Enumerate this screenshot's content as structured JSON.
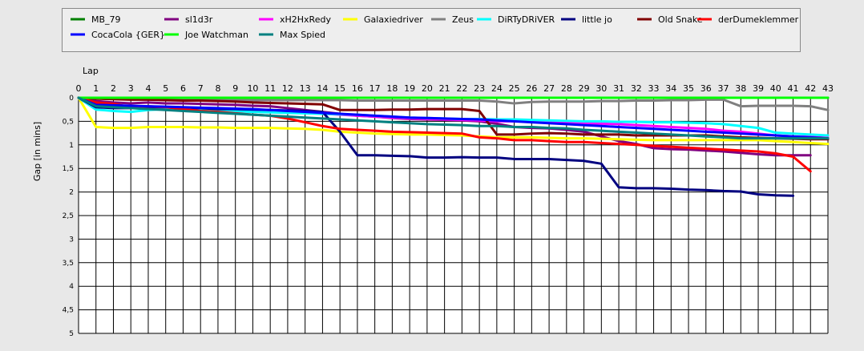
{
  "chart_data": {
    "type": "line",
    "xlabel": "Lap",
    "ylabel": "Gap [in mins]",
    "xlim": [
      0,
      43
    ],
    "ylim": [
      0,
      5
    ],
    "y_inverted": true,
    "grid": true,
    "legend_position": "top",
    "x_ticks": [
      "0",
      "1",
      "2",
      "3",
      "4",
      "5",
      "6",
      "7",
      "8",
      "9",
      "10",
      "11",
      "12",
      "13",
      "14",
      "15",
      "16",
      "17",
      "18",
      "19",
      "20",
      "21",
      "22",
      "23",
      "24",
      "25",
      "26",
      "27",
      "28",
      "29",
      "30",
      "31",
      "32",
      "33",
      "34",
      "35",
      "36",
      "37",
      "38",
      "39",
      "40",
      "41",
      "42",
      "43"
    ],
    "y_ticks": [
      "0",
      "0,5",
      "1",
      "1,5",
      "2",
      "2,5",
      "3",
      "3,5",
      "4",
      "4,5",
      "5"
    ],
    "series": [
      {
        "name": "MB_79",
        "color": "#008000",
        "x": [
          0,
          1,
          5,
          10,
          15,
          20,
          25,
          30,
          35,
          40,
          43
        ],
        "values": [
          0,
          0,
          0,
          0,
          0,
          0,
          0,
          0,
          0,
          0,
          0
        ]
      },
      {
        "name": "sl1d3r",
        "color": "#800080",
        "x": [
          0,
          1,
          2,
          3,
          4,
          5,
          6,
          7,
          8,
          9,
          10,
          11,
          12,
          13,
          14,
          15,
          16,
          17,
          18,
          19,
          20,
          21,
          22,
          23,
          24,
          25,
          26,
          27,
          28,
          29,
          30,
          31,
          32,
          33,
          34,
          35,
          36,
          37,
          38,
          39,
          40,
          41,
          42
        ],
        "values": [
          0,
          0.07,
          0.1,
          0.12,
          0.1,
          0.12,
          0.12,
          0.13,
          0.14,
          0.15,
          0.17,
          0.18,
          0.22,
          0.26,
          0.3,
          0.34,
          0.38,
          0.4,
          0.43,
          0.45,
          0.46,
          0.47,
          0.48,
          0.5,
          0.55,
          0.62,
          0.64,
          0.65,
          0.68,
          0.72,
          0.82,
          0.92,
          0.98,
          1.07,
          1.09,
          1.1,
          1.12,
          1.14,
          1.17,
          1.2,
          1.22,
          1.22,
          1.22
        ]
      },
      {
        "name": "xH2HxRedy",
        "color": "#ff00ff",
        "x": [
          0,
          1,
          2,
          3,
          4,
          5,
          6,
          7,
          8,
          9,
          10,
          11,
          12,
          13,
          14,
          15,
          16,
          17,
          18,
          19,
          20,
          21,
          22,
          23,
          24,
          25,
          26,
          27,
          28,
          29,
          30,
          31,
          32,
          33,
          34,
          35,
          36,
          37,
          38,
          39,
          40,
          41,
          42,
          43
        ],
        "values": [
          0,
          0.12,
          0.2,
          0.2,
          0.2,
          0.2,
          0.21,
          0.22,
          0.23,
          0.24,
          0.26,
          0.28,
          0.3,
          0.32,
          0.34,
          0.36,
          0.38,
          0.4,
          0.42,
          0.44,
          0.45,
          0.46,
          0.47,
          0.48,
          0.5,
          0.5,
          0.5,
          0.51,
          0.52,
          0.54,
          0.55,
          0.56,
          0.58,
          0.6,
          0.62,
          0.64,
          0.66,
          0.7,
          0.72,
          0.76,
          0.8,
          0.82,
          0.83,
          0.85
        ]
      },
      {
        "name": "Galaxiedriver",
        "color": "#ffff00",
        "x": [
          0,
          1,
          2,
          3,
          4,
          5,
          6,
          7,
          8,
          9,
          10,
          11,
          12,
          13,
          14,
          15,
          16,
          17,
          18,
          19,
          20,
          21,
          22,
          23,
          24,
          25,
          26,
          27,
          28,
          29,
          30,
          31,
          32,
          33,
          34,
          35,
          36,
          37,
          38,
          39,
          40,
          41,
          42,
          43
        ],
        "values": [
          0,
          0.62,
          0.64,
          0.64,
          0.62,
          0.62,
          0.62,
          0.63,
          0.63,
          0.64,
          0.64,
          0.64,
          0.65,
          0.66,
          0.68,
          0.72,
          0.74,
          0.76,
          0.77,
          0.78,
          0.78,
          0.79,
          0.8,
          0.82,
          0.84,
          0.84,
          0.84,
          0.85,
          0.86,
          0.86,
          0.87,
          0.88,
          0.89,
          0.9,
          0.9,
          0.9,
          0.9,
          0.9,
          0.9,
          0.9,
          0.92,
          0.94,
          0.96,
          0.98
        ]
      },
      {
        "name": "Zeus",
        "color": "#808080",
        "x": [
          0,
          1,
          2,
          3,
          4,
          5,
          6,
          7,
          8,
          9,
          10,
          11,
          12,
          13,
          14,
          15,
          16,
          17,
          18,
          19,
          20,
          21,
          22,
          23,
          24,
          25,
          26,
          27,
          28,
          29,
          30,
          31,
          32,
          33,
          34,
          35,
          36,
          37,
          38,
          39,
          40,
          41,
          42,
          43
        ],
        "values": [
          0,
          0.01,
          0.02,
          0.02,
          0.03,
          0.03,
          0.03,
          0.04,
          0.04,
          0.05,
          0.05,
          0.05,
          0.05,
          0.05,
          0.05,
          0.05,
          0.06,
          0.06,
          0.06,
          0.06,
          0.06,
          0.06,
          0.06,
          0.06,
          0.08,
          0.12,
          0.09,
          0.08,
          0.08,
          0.08,
          0.07,
          0.07,
          0.06,
          0.06,
          0.05,
          0.05,
          0.04,
          0.04,
          0.18,
          0.17,
          0.17,
          0.17,
          0.18,
          0.26
        ]
      },
      {
        "name": "DiRTyDRiVER",
        "color": "#00ffff",
        "x": [
          0,
          1,
          2,
          3,
          4,
          5,
          6,
          7,
          8,
          9,
          10,
          11,
          12,
          13,
          14,
          15,
          16,
          17,
          18,
          19,
          20,
          21,
          22,
          23,
          24,
          25,
          26,
          27,
          28,
          29,
          30,
          31,
          32,
          33,
          34,
          35,
          36,
          37,
          38,
          39,
          40,
          41,
          42,
          43
        ],
        "values": [
          0,
          0.25,
          0.28,
          0.3,
          0.26,
          0.24,
          0.26,
          0.27,
          0.28,
          0.29,
          0.3,
          0.31,
          0.32,
          0.33,
          0.34,
          0.35,
          0.36,
          0.38,
          0.4,
          0.42,
          0.43,
          0.44,
          0.45,
          0.45,
          0.46,
          0.46,
          0.47,
          0.48,
          0.49,
          0.5,
          0.5,
          0.51,
          0.51,
          0.52,
          0.52,
          0.53,
          0.54,
          0.56,
          0.6,
          0.64,
          0.74,
          0.76,
          0.78,
          0.8
        ]
      },
      {
        "name": "little jo",
        "color": "#000080",
        "x": [
          0,
          1,
          2,
          3,
          4,
          5,
          6,
          7,
          8,
          9,
          10,
          11,
          12,
          13,
          14,
          15,
          16,
          17,
          18,
          19,
          20,
          21,
          22,
          23,
          24,
          25,
          26,
          27,
          28,
          29,
          30,
          31,
          32,
          33,
          34,
          35,
          36,
          37,
          38,
          39,
          40,
          41
        ],
        "values": [
          0,
          0.2,
          0.22,
          0.22,
          0.2,
          0.2,
          0.22,
          0.22,
          0.24,
          0.24,
          0.25,
          0.26,
          0.27,
          0.28,
          0.3,
          0.72,
          1.22,
          1.22,
          1.23,
          1.24,
          1.27,
          1.27,
          1.26,
          1.27,
          1.27,
          1.3,
          1.3,
          1.3,
          1.32,
          1.34,
          1.4,
          1.9,
          1.92,
          1.92,
          1.93,
          1.95,
          1.96,
          1.98,
          1.99,
          2.05,
          2.07,
          2.08
        ]
      },
      {
        "name": "Old Snake",
        "color": "#800000",
        "x": [
          0,
          1,
          2,
          3,
          4,
          5,
          6,
          7,
          8,
          9,
          10,
          11,
          12,
          13,
          14,
          15,
          16,
          17,
          18,
          19,
          20,
          21,
          22,
          23,
          24,
          25,
          26,
          27,
          28,
          29,
          30,
          31,
          32,
          33,
          34,
          35,
          36,
          37,
          38,
          39,
          40,
          41,
          42,
          43
        ],
        "values": [
          0,
          0.02,
          0.03,
          0.04,
          0.04,
          0.05,
          0.06,
          0.06,
          0.07,
          0.08,
          0.1,
          0.11,
          0.12,
          0.13,
          0.14,
          0.26,
          0.26,
          0.26,
          0.25,
          0.25,
          0.24,
          0.24,
          0.24,
          0.28,
          0.78,
          0.78,
          0.76,
          0.75,
          0.76,
          0.78,
          0.78,
          0.78,
          0.8,
          0.8,
          0.8,
          0.8,
          0.8,
          0.82,
          0.84,
          0.85,
          0.86,
          0.87,
          0.88,
          0.88
        ]
      },
      {
        "name": "derDumeklemmer",
        "color": "#ff0000",
        "x": [
          0,
          1,
          2,
          3,
          4,
          5,
          6,
          7,
          8,
          9,
          10,
          11,
          12,
          13,
          14,
          15,
          16,
          17,
          18,
          19,
          20,
          21,
          22,
          23,
          24,
          25,
          26,
          27,
          28,
          29,
          30,
          31,
          32,
          33,
          34,
          35,
          36,
          37,
          38,
          39,
          40,
          41,
          42
        ],
        "values": [
          0,
          0.1,
          0.13,
          0.2,
          0.18,
          0.2,
          0.24,
          0.28,
          0.3,
          0.33,
          0.36,
          0.38,
          0.44,
          0.52,
          0.6,
          0.66,
          0.68,
          0.7,
          0.72,
          0.73,
          0.74,
          0.75,
          0.76,
          0.84,
          0.86,
          0.9,
          0.9,
          0.92,
          0.94,
          0.94,
          0.96,
          0.98,
          1.0,
          1.02,
          1.04,
          1.06,
          1.08,
          1.1,
          1.12,
          1.14,
          1.18,
          1.25,
          1.56
        ]
      },
      {
        "name": "CocaCola {GER}",
        "color": "#0000ff",
        "x": [
          0,
          1,
          2,
          3,
          4,
          5,
          6,
          7,
          8,
          9,
          10,
          11,
          12,
          13,
          14,
          15,
          16,
          17,
          18,
          19,
          20,
          21,
          22,
          23,
          24,
          25,
          26,
          27,
          28,
          29,
          30,
          31,
          32,
          33,
          34,
          35,
          36,
          37,
          38,
          39,
          40,
          41,
          42,
          43
        ],
        "values": [
          0,
          0.15,
          0.16,
          0.17,
          0.18,
          0.19,
          0.2,
          0.21,
          0.22,
          0.23,
          0.24,
          0.26,
          0.28,
          0.3,
          0.32,
          0.34,
          0.36,
          0.38,
          0.4,
          0.42,
          0.43,
          0.44,
          0.45,
          0.46,
          0.48,
          0.5,
          0.52,
          0.54,
          0.56,
          0.58,
          0.6,
          0.62,
          0.64,
          0.66,
          0.68,
          0.7,
          0.72,
          0.74,
          0.76,
          0.78,
          0.8,
          0.82,
          0.84,
          0.86
        ]
      },
      {
        "name": "Joe Watchman",
        "color": "#00ff00",
        "x": [
          0,
          1,
          5,
          10,
          15,
          20,
          25,
          30,
          35,
          40,
          43
        ],
        "values": [
          0,
          0,
          0,
          0,
          0,
          0,
          0,
          0,
          0,
          0,
          0
        ]
      },
      {
        "name": "Max Spied",
        "color": "#008080",
        "x": [
          0,
          1,
          2,
          3,
          4,
          5,
          6,
          7,
          8,
          9,
          10,
          11,
          12,
          13,
          14,
          15,
          16,
          17,
          18,
          19,
          20,
          21,
          22,
          23,
          24,
          25,
          26,
          27,
          28,
          29,
          30,
          31,
          32,
          33,
          34,
          35,
          36,
          37,
          38,
          39,
          40,
          41,
          42,
          43
        ],
        "values": [
          0,
          0.18,
          0.2,
          0.22,
          0.24,
          0.26,
          0.28,
          0.3,
          0.32,
          0.34,
          0.36,
          0.38,
          0.4,
          0.42,
          0.44,
          0.46,
          0.48,
          0.5,
          0.52,
          0.54,
          0.56,
          0.57,
          0.58,
          0.6,
          0.6,
          0.62,
          0.62,
          0.64,
          0.65,
          0.68,
          0.7,
          0.72,
          0.74,
          0.76,
          0.78,
          0.8,
          0.82,
          0.84,
          0.86,
          0.86,
          0.86,
          0.86,
          0.86,
          0.86
        ]
      }
    ]
  }
}
